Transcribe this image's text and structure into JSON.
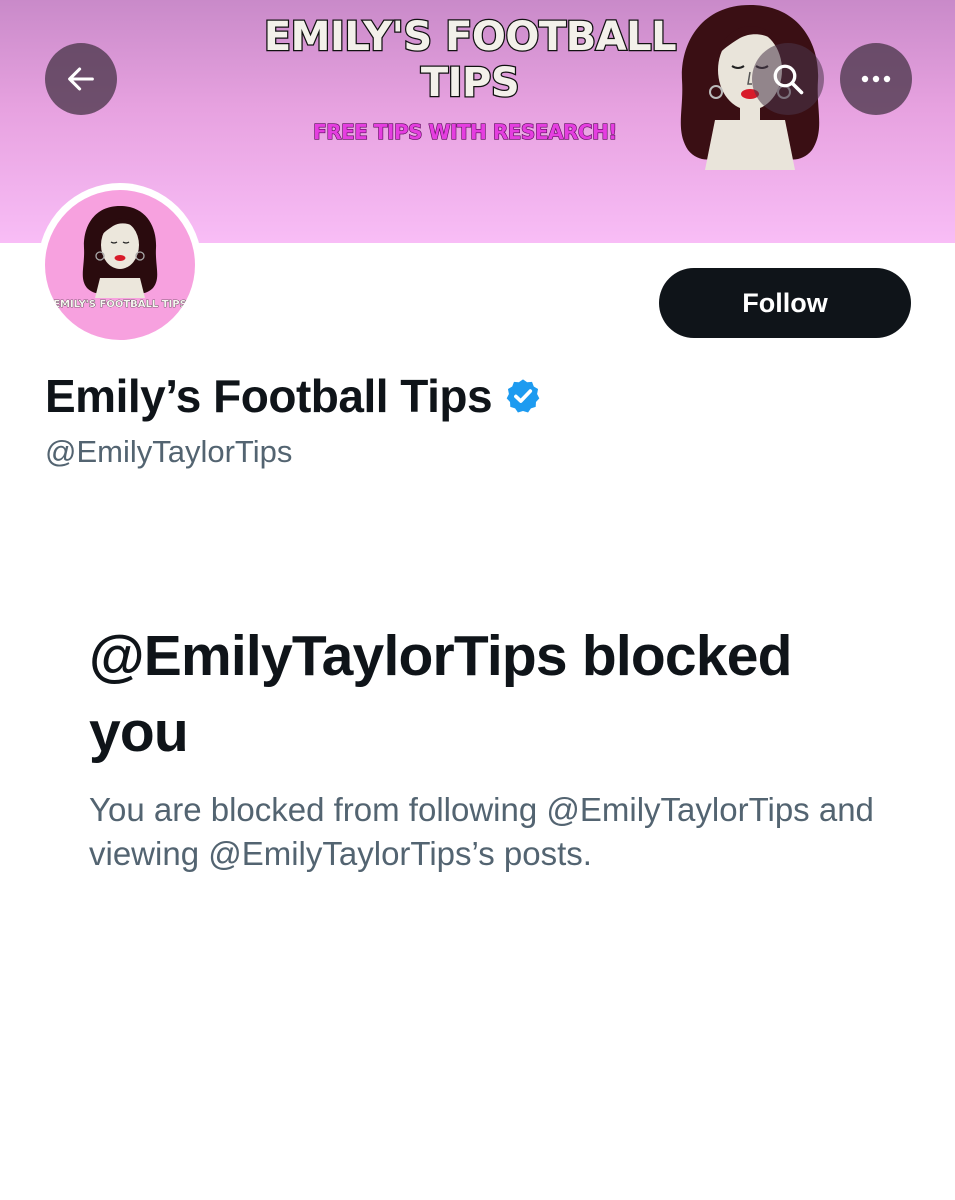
{
  "banner": {
    "title": "EMILY'S FOOTBALL TIPS",
    "subtitle": "FREE TIPS WITH RESEARCH!"
  },
  "header": {
    "back_icon": "arrow-left-icon",
    "search_icon": "search-icon",
    "more_icon": "more-horizontal-icon"
  },
  "avatar": {
    "text": "EMILY'S FOOTBALL TIPS"
  },
  "profile": {
    "follow_label": "Follow",
    "display_name": "Emily’s Football Tips",
    "verified": true,
    "verified_color": "#1d9bf0",
    "handle": "@EmilyTaylorTips"
  },
  "blocked": {
    "title": "@EmilyTaylorTips blocked you",
    "description": "You are blocked from following @EmilyTaylorTips and viewing @EmilyTaylorTips’s posts."
  },
  "colors": {
    "primary_text": "#0f1419",
    "secondary_text": "#536471",
    "banner_pink": "#f8bdf6"
  }
}
